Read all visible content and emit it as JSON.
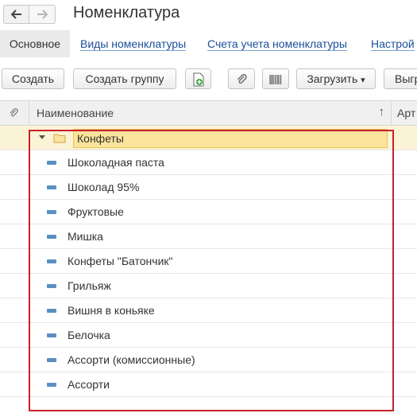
{
  "window": {
    "title": "Номенклатура"
  },
  "nav": {
    "back_icon": "arrow-left-icon",
    "forward_icon": "arrow-right-icon"
  },
  "tabs": [
    {
      "label": "Основное",
      "active": true
    },
    {
      "label": "Виды номенклатуры",
      "active": false
    },
    {
      "label": "Счета учета номенклатуры",
      "active": false
    },
    {
      "label": "Настрой",
      "active": false
    }
  ],
  "toolbar": {
    "create": "Создать",
    "create_group": "Создать группу",
    "load": "Загрузить",
    "load_arrow": "▾",
    "more": "Выгр"
  },
  "table": {
    "headers": {
      "name": "Наименование",
      "sort_indicator": "↑",
      "article": "Арт"
    },
    "group": "Конфеты",
    "items": [
      "Шоколадная паста",
      "Шоколад 95%",
      "Фруктовые",
      "Мишка",
      "Конфеты \"Батончик\"",
      "Грильяж",
      "Вишня в коньяке",
      "Белочка",
      "Ассорти (комиссионные)",
      "Ассорти"
    ]
  },
  "colors": {
    "link": "#1b4f9a",
    "highlight": "#fbe49b",
    "annotation": "#c8202b",
    "item_marker": "#5b8fc4"
  }
}
